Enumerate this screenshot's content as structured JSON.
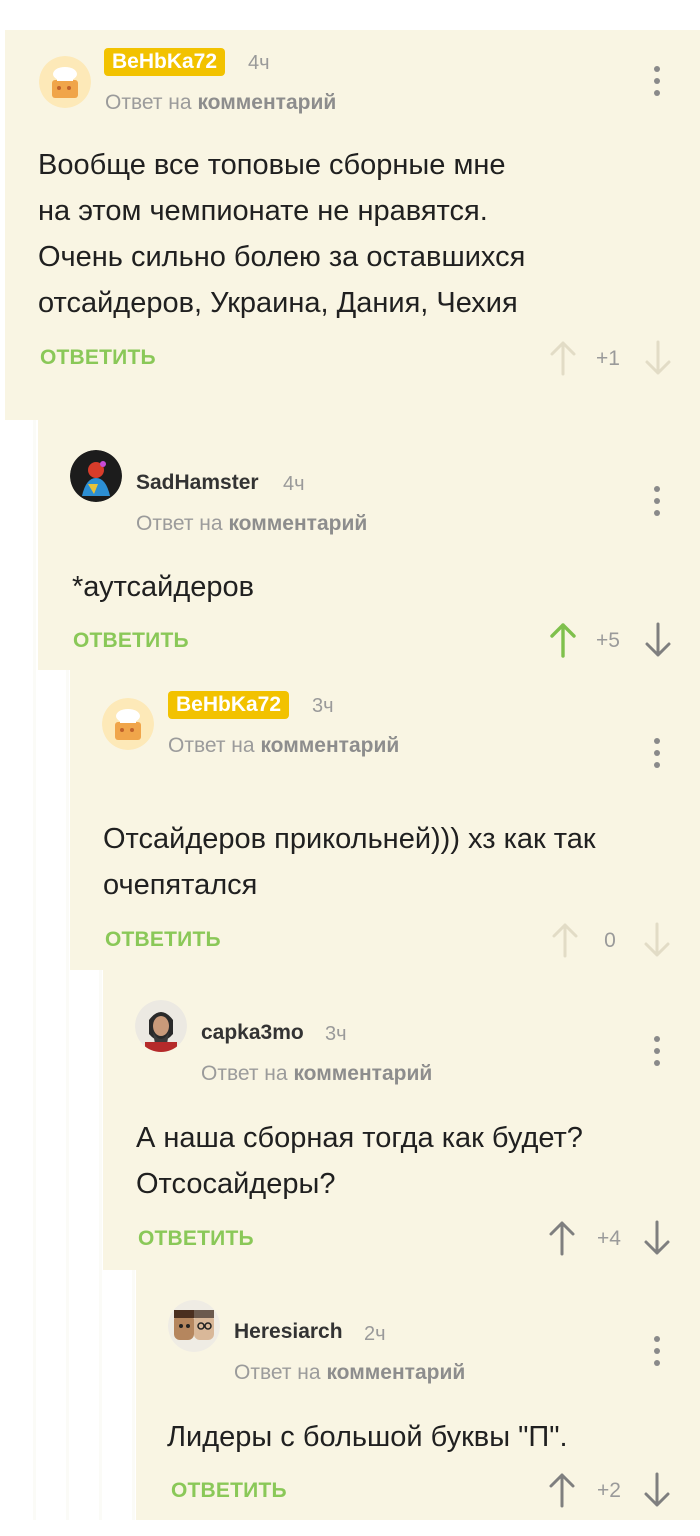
{
  "colors": {
    "comment_bg": "#f9f5e3",
    "accent_green": "#8ac858",
    "badge_yellow": "#f2c200",
    "muted_text": "#9a9a9a",
    "upvote_active": "#8ac858"
  },
  "comments": [
    {
      "author": "BeHbKa72",
      "time": "4ч",
      "reply_prefix": "Ответ на",
      "reply_target": "комментарий",
      "lines": [
        "Вообще все топовые сборные мне",
        "на этом чемпионате не нравятся.",
        "Очень сильно болею за оставшихся",
        "отсайдеров, Украина, Дания, Чехия"
      ],
      "reply_label": "ОТВЕТИТЬ",
      "rating": "+1",
      "upvoted": false,
      "avatar_icon": "chef-avatar-icon"
    },
    {
      "author": "SadHamster",
      "time": "4ч",
      "reply_prefix": "Ответ на",
      "reply_target": "комментарий",
      "lines": [
        "*аутсайдеров"
      ],
      "reply_label": "ОТВЕТИТЬ",
      "rating": "+5",
      "upvoted": true,
      "avatar_icon": "colorful-figure-avatar-icon"
    },
    {
      "author": "BeHbKa72",
      "time": "3ч",
      "reply_prefix": "Ответ на",
      "reply_target": "комментарий",
      "lines": [
        "Отсайдеров прикольней))) хз как так",
        "очепятался"
      ],
      "reply_label": "ОТВЕТИТЬ",
      "rating": "0",
      "upvoted": false,
      "avatar_icon": "chef-avatar-icon"
    },
    {
      "author": "capka3mo",
      "time": "3ч",
      "reply_prefix": "Ответ на",
      "reply_target": "комментарий",
      "lines": [
        "А наша сборная тогда как будет?",
        "Отсосайдеры?"
      ],
      "reply_label": "ОТВЕТИТЬ",
      "rating": "+4",
      "upvoted": false,
      "avatar_icon": "bearded-man-avatar-icon"
    },
    {
      "author": "Heresiarch",
      "time": "2ч",
      "reply_prefix": "Ответ на",
      "reply_target": "комментарий",
      "lines": [
        "Лидеры с большой буквы \"П\"."
      ],
      "reply_label": "ОТВЕТИТЬ",
      "rating": "+2",
      "upvoted": false,
      "avatar_icon": "two-faces-avatar-icon"
    }
  ]
}
